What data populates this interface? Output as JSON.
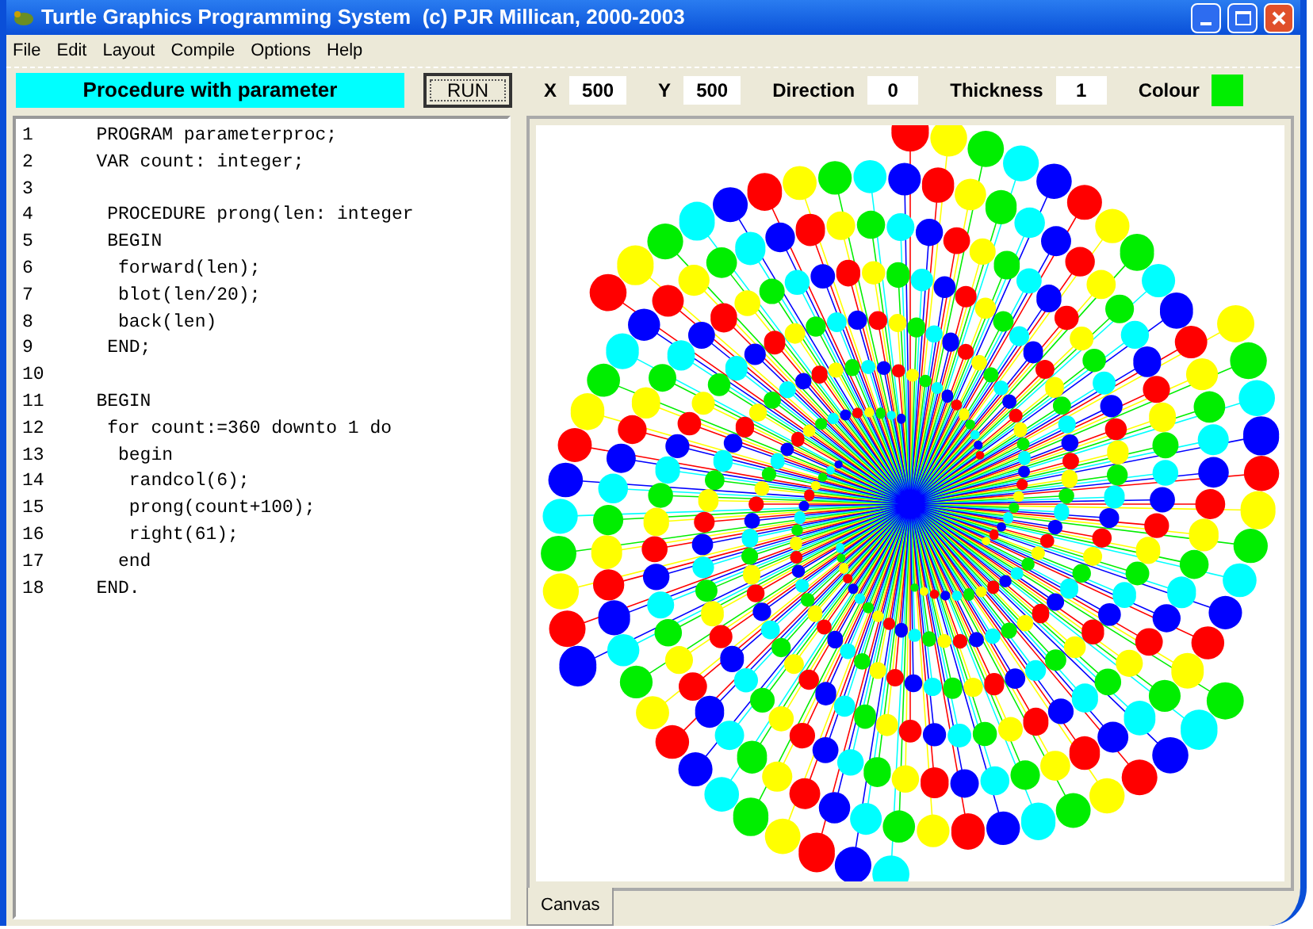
{
  "window": {
    "title": "Turtle Graphics Programming System  (c) PJR Millican, 2000-2003"
  },
  "menu": [
    "File",
    "Edit",
    "Layout",
    "Compile",
    "Options",
    "Help"
  ],
  "toolbar": {
    "program_title": "Procedure with parameter",
    "run_button": "RUN",
    "fields": [
      {
        "label": "X",
        "value": "500"
      },
      {
        "label": "Y",
        "value": "500"
      },
      {
        "label": "Direction",
        "value": "0"
      },
      {
        "label": "Thickness",
        "value": "1"
      }
    ],
    "colour": {
      "label": "Colour",
      "color": "#00ee00"
    }
  },
  "editor": {
    "lines": [
      {
        "number": "1",
        "code": "   PROGRAM parameterproc;"
      },
      {
        "number": "2",
        "code": "   VAR count: integer;"
      },
      {
        "number": "3"
      },
      {
        "number": "4",
        "code": "    PROCEDURE prong(len: integer"
      },
      {
        "number": "5",
        "code": "    BEGIN"
      },
      {
        "number": "6",
        "code": "     forward(len);"
      },
      {
        "number": "7",
        "code": "     blot(len/20);"
      },
      {
        "number": "8",
        "code": "     back(len)"
      },
      {
        "number": "9",
        "code": "    END;"
      },
      {
        "number": "10"
      },
      {
        "number": "11",
        "code": "   BEGIN"
      },
      {
        "number": "12",
        "code": "    for count:=360 downto 1 do"
      },
      {
        "number": "13",
        "code": "     begin"
      },
      {
        "number": "14",
        "code": "      randcol(6);"
      },
      {
        "number": "15",
        "code": "      prong(count+100);"
      },
      {
        "number": "16",
        "code": "      right(61);"
      },
      {
        "number": "17",
        "code": "     end"
      },
      {
        "number": "18",
        "code": "   END."
      }
    ]
  },
  "tabs": [
    {
      "label": "Canvas",
      "selected": true
    }
  ]
}
